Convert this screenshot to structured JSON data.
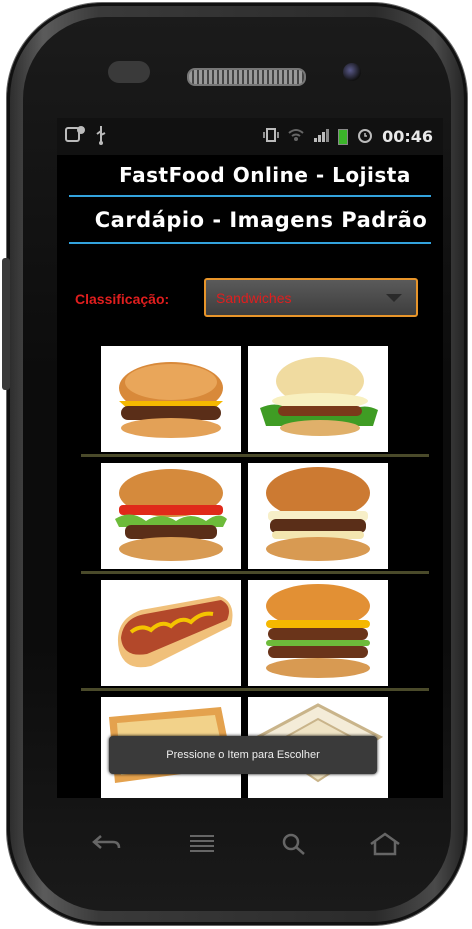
{
  "app": {
    "title": "FastFood Online - Lojista",
    "subtitle": "Cardápio - Imagens Padrão"
  },
  "status": {
    "time": "00:46"
  },
  "filter": {
    "label": "Classificação:",
    "selected": "Sandwiches"
  },
  "toast": {
    "message": "Pressione o Item para Escolher"
  },
  "images": [
    {
      "icon": "cheeseburger-image"
    },
    {
      "icon": "lettuce-burger-image"
    },
    {
      "icon": "tomato-burger-image"
    },
    {
      "icon": "cheese-burger-image"
    },
    {
      "icon": "hotdog-image"
    },
    {
      "icon": "double-burger-image"
    },
    {
      "icon": "toast-sandwich-image"
    },
    {
      "icon": "white-bread-sandwich-image"
    }
  ],
  "colors": {
    "accent_blue": "#33a3dd",
    "label_red": "#e01e1e",
    "select_border": "#e8952a"
  }
}
